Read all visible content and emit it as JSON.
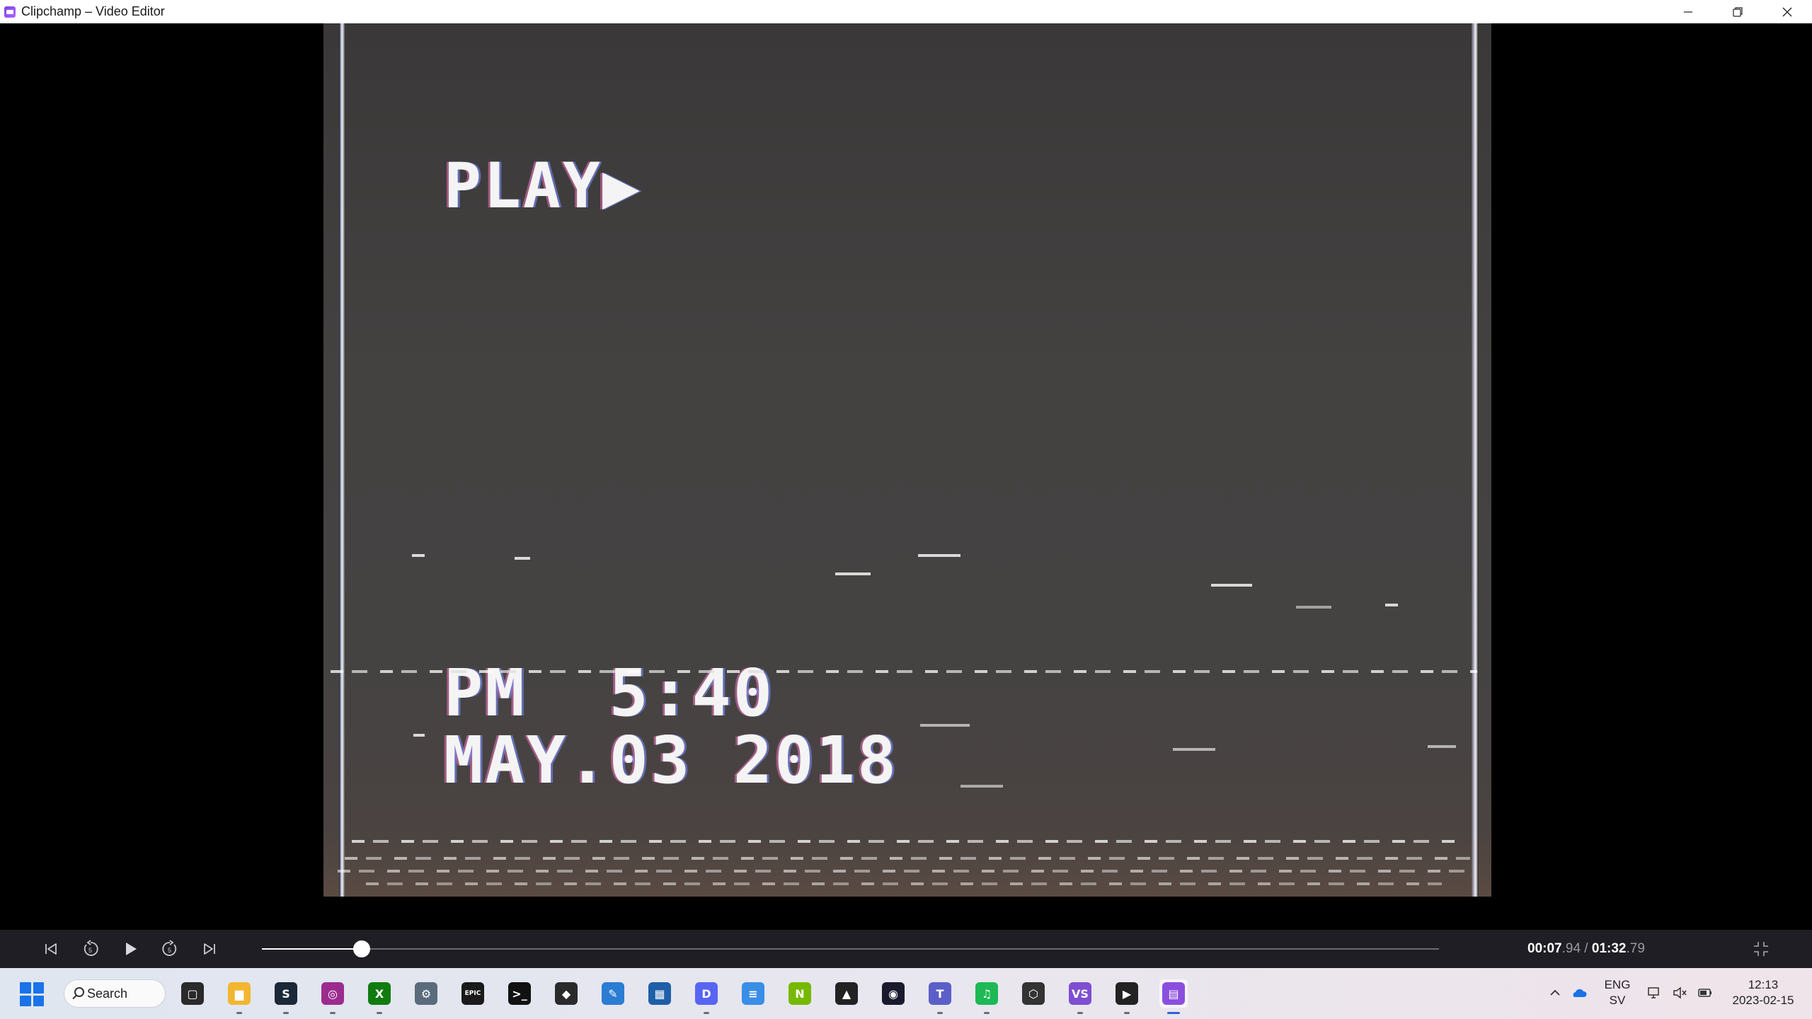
{
  "window": {
    "title": "Clipchamp – Video Editor",
    "controls": [
      "minimize",
      "restore",
      "close"
    ]
  },
  "video": {
    "overlay_play": "PLAY▶",
    "overlay_time": "PM  5:40",
    "overlay_date": "MAY.03 2018"
  },
  "player": {
    "progress_fraction": 0.085,
    "time_current_main": "00:07",
    "time_current_frac": ".94",
    "time_sep": " / ",
    "time_total_main": "01:32",
    "time_total_frac": ".79",
    "buttons": [
      "skip-back",
      "rewind-5",
      "play",
      "forward-5",
      "skip-forward",
      "exit-fullscreen"
    ]
  },
  "taskbar": {
    "search_label": "Search",
    "apps": [
      {
        "name": "task-view",
        "color": "#2a2a2a",
        "glyph": "▢"
      },
      {
        "name": "file-explorer",
        "color": "#f2b631",
        "glyph": "▆"
      },
      {
        "name": "steam",
        "color": "#1b2838",
        "glyph": "S"
      },
      {
        "name": "podcast-app",
        "color": "#9b2c8e",
        "glyph": "◎"
      },
      {
        "name": "xbox",
        "color": "#107c10",
        "glyph": "X"
      },
      {
        "name": "settings",
        "color": "#5a6b7c",
        "glyph": "⚙"
      },
      {
        "name": "epic-games",
        "color": "#1a1a1a",
        "glyph": "EPIC"
      },
      {
        "name": "terminal",
        "color": "#111",
        "glyph": ">_"
      },
      {
        "name": "unity",
        "color": "#2a2a2a",
        "glyph": "◆"
      },
      {
        "name": "paint-app",
        "color": "#2b7cd3",
        "glyph": "✎"
      },
      {
        "name": "photos-app",
        "color": "#1e5fa8",
        "glyph": "▦"
      },
      {
        "name": "discord",
        "color": "#5865f2",
        "glyph": "D"
      },
      {
        "name": "notepad",
        "color": "#3a8ee6",
        "glyph": "≡"
      },
      {
        "name": "nvidia",
        "color": "#76b900",
        "glyph": "N"
      },
      {
        "name": "inkscape",
        "color": "#222",
        "glyph": "▲"
      },
      {
        "name": "uplay",
        "color": "#1a1a2e",
        "glyph": "◉"
      },
      {
        "name": "teams",
        "color": "#5b5fc7",
        "glyph": "T"
      },
      {
        "name": "spotify",
        "color": "#1db954",
        "glyph": "♫"
      },
      {
        "name": "unity-hub",
        "color": "#333",
        "glyph": "⬡"
      },
      {
        "name": "visual-studio",
        "color": "#7e4fd1",
        "glyph": "VS"
      },
      {
        "name": "media-player",
        "color": "#222",
        "glyph": "▶"
      },
      {
        "name": "clipchamp",
        "color": "#8b4fe0",
        "glyph": "▤"
      }
    ]
  },
  "tray": {
    "lang_top": "ENG",
    "lang_bottom": "SV",
    "time": "12:13",
    "date": "2023-02-15"
  }
}
